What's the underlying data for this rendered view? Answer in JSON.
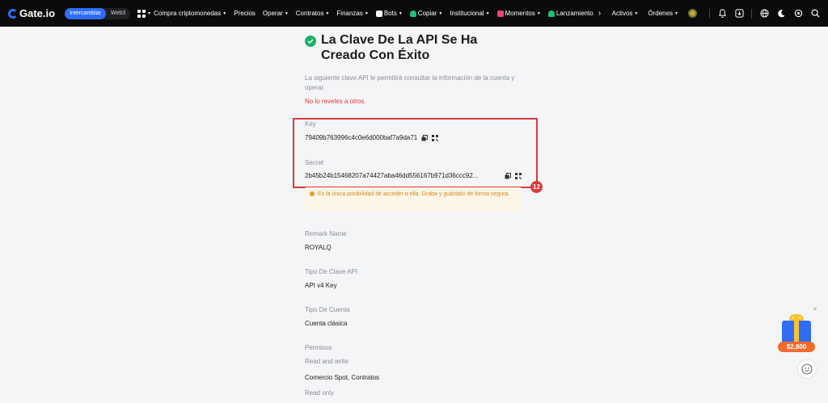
{
  "brand": {
    "name": "Gate.io"
  },
  "mode_toggle": {
    "active": "Intercambiar",
    "inactive": "Web3"
  },
  "nav": [
    {
      "label": "Compra criptomonedas",
      "caret": true
    },
    {
      "label": "Precios",
      "caret": false
    },
    {
      "label": "Operar",
      "caret": true
    },
    {
      "label": "Contratos",
      "caret": true
    },
    {
      "label": "Finanzas",
      "caret": true
    },
    {
      "label": "Bots",
      "caret": true
    },
    {
      "label": "Copiar",
      "caret": true
    },
    {
      "label": "Institucional",
      "caret": true
    },
    {
      "label": "Momentos",
      "caret": true
    },
    {
      "label": "Lanzamiento",
      "caret": false
    }
  ],
  "right_nav": {
    "assets": "Activos",
    "orders": "Órdenes"
  },
  "page": {
    "title": "La Clave De La API Se Ha Creado Con Éxito",
    "description": "La siguiente clave API le permitirá consultar la información de la cuenta y operar.",
    "warning": "No lo reveles a otros."
  },
  "key": {
    "label": "Key",
    "value": "79409b763996c4c0e6d000baf7a9da71"
  },
  "secret": {
    "label": "Secret",
    "value": "2b45b24b15468207a74427aba46dd556167b971d36ccc92..."
  },
  "step_number": "12",
  "notice": "Es la única posibilidad de acceder a ella. Graba y guárdalo de forma segura.",
  "details": {
    "remark_label": "Remark Name",
    "remark_value": "ROYALQ",
    "key_type_label": "Tipo De Clave API",
    "key_type_value": "API v4 Key",
    "account_type_label": "Tipo De Cuenta",
    "account_type_value": "Cuenta clásica",
    "permissions_label": "Permisos",
    "perm1_mode": "Read and write",
    "perm1_value": "Comercio Spot, Contratos",
    "perm2_mode": "Read only"
  },
  "gift": {
    "amount": "$2,800"
  },
  "colors": {
    "accent": "#2f6df6",
    "success": "#18b26b",
    "danger": "#d93a3a",
    "warning": "#e59a28"
  }
}
